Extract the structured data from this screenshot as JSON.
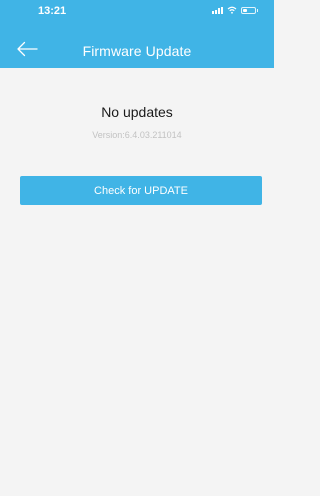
{
  "status_bar": {
    "time": "13:21"
  },
  "header": {
    "title": "Firmware Update",
    "back_icon": "arrow-left-icon"
  },
  "main": {
    "status_text": "No updates",
    "version_text": "Version:6.4.03.211014",
    "check_button_label": "Check for UPDATE"
  },
  "colors": {
    "accent": "#40b4e6",
    "background": "#f4f4f4",
    "version_text": "#c2c2c2"
  }
}
